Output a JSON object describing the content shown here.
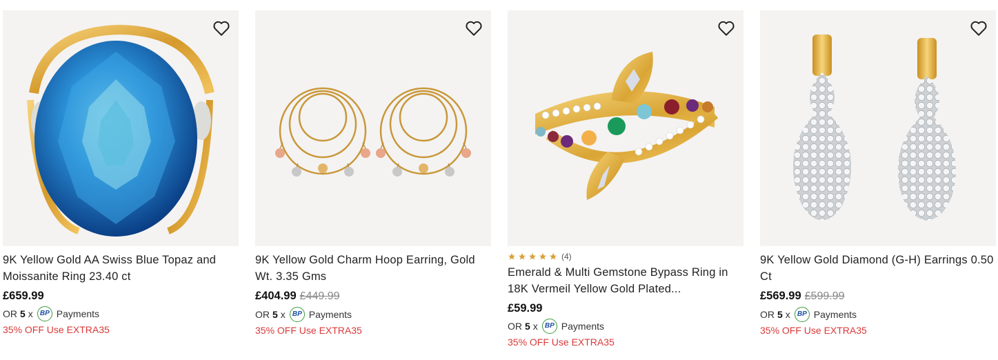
{
  "products": [
    {
      "title": "9K Yellow Gold AA Swiss Blue Topaz and Moissanite Ring 23.40 ct",
      "price": "£659.99",
      "was_price": "",
      "pay_or": "OR",
      "pay_count": "5",
      "pay_x": "x",
      "pay_logo": "BP",
      "pay_label": "Payments",
      "offer": "35% OFF Use EXTRA35",
      "image_icon": "blue-topaz-ring"
    },
    {
      "title": "9K Yellow Gold Charm Hoop Earring, Gold Wt. 3.35 Gms",
      "price": "£404.99",
      "was_price": "£449.99",
      "pay_or": "OR",
      "pay_count": "5",
      "pay_x": "x",
      "pay_logo": "BP",
      "pay_label": "Payments",
      "offer": "35% OFF Use EXTRA35",
      "image_icon": "hoop-earrings"
    },
    {
      "rating_count": "(4)",
      "rating_value": 5,
      "title": "Emerald & Multi Gemstone Bypass Ring in 18K Vermeil Yellow Gold Plated...",
      "price": "£59.99",
      "was_price": "",
      "pay_or": "OR",
      "pay_count": "5",
      "pay_x": "x",
      "pay_logo": "BP",
      "pay_label": "Payments",
      "offer": "35% OFF Use EXTRA35",
      "image_icon": "multi-gem-ring"
    },
    {
      "title": "9K Yellow Gold Diamond (G-H) Earrings 0.50 Ct",
      "price": "£569.99",
      "was_price": "£599.99",
      "pay_or": "OR",
      "pay_count": "5",
      "pay_x": "x",
      "pay_logo": "BP",
      "pay_label": "Payments",
      "offer": "35% OFF Use EXTRA35",
      "image_icon": "diamond-drop-earrings"
    }
  ],
  "colors": {
    "image_bg": "#f4f3f2",
    "offer": "#d93838",
    "star": "#d7a23a",
    "gold": "#e0b046"
  }
}
